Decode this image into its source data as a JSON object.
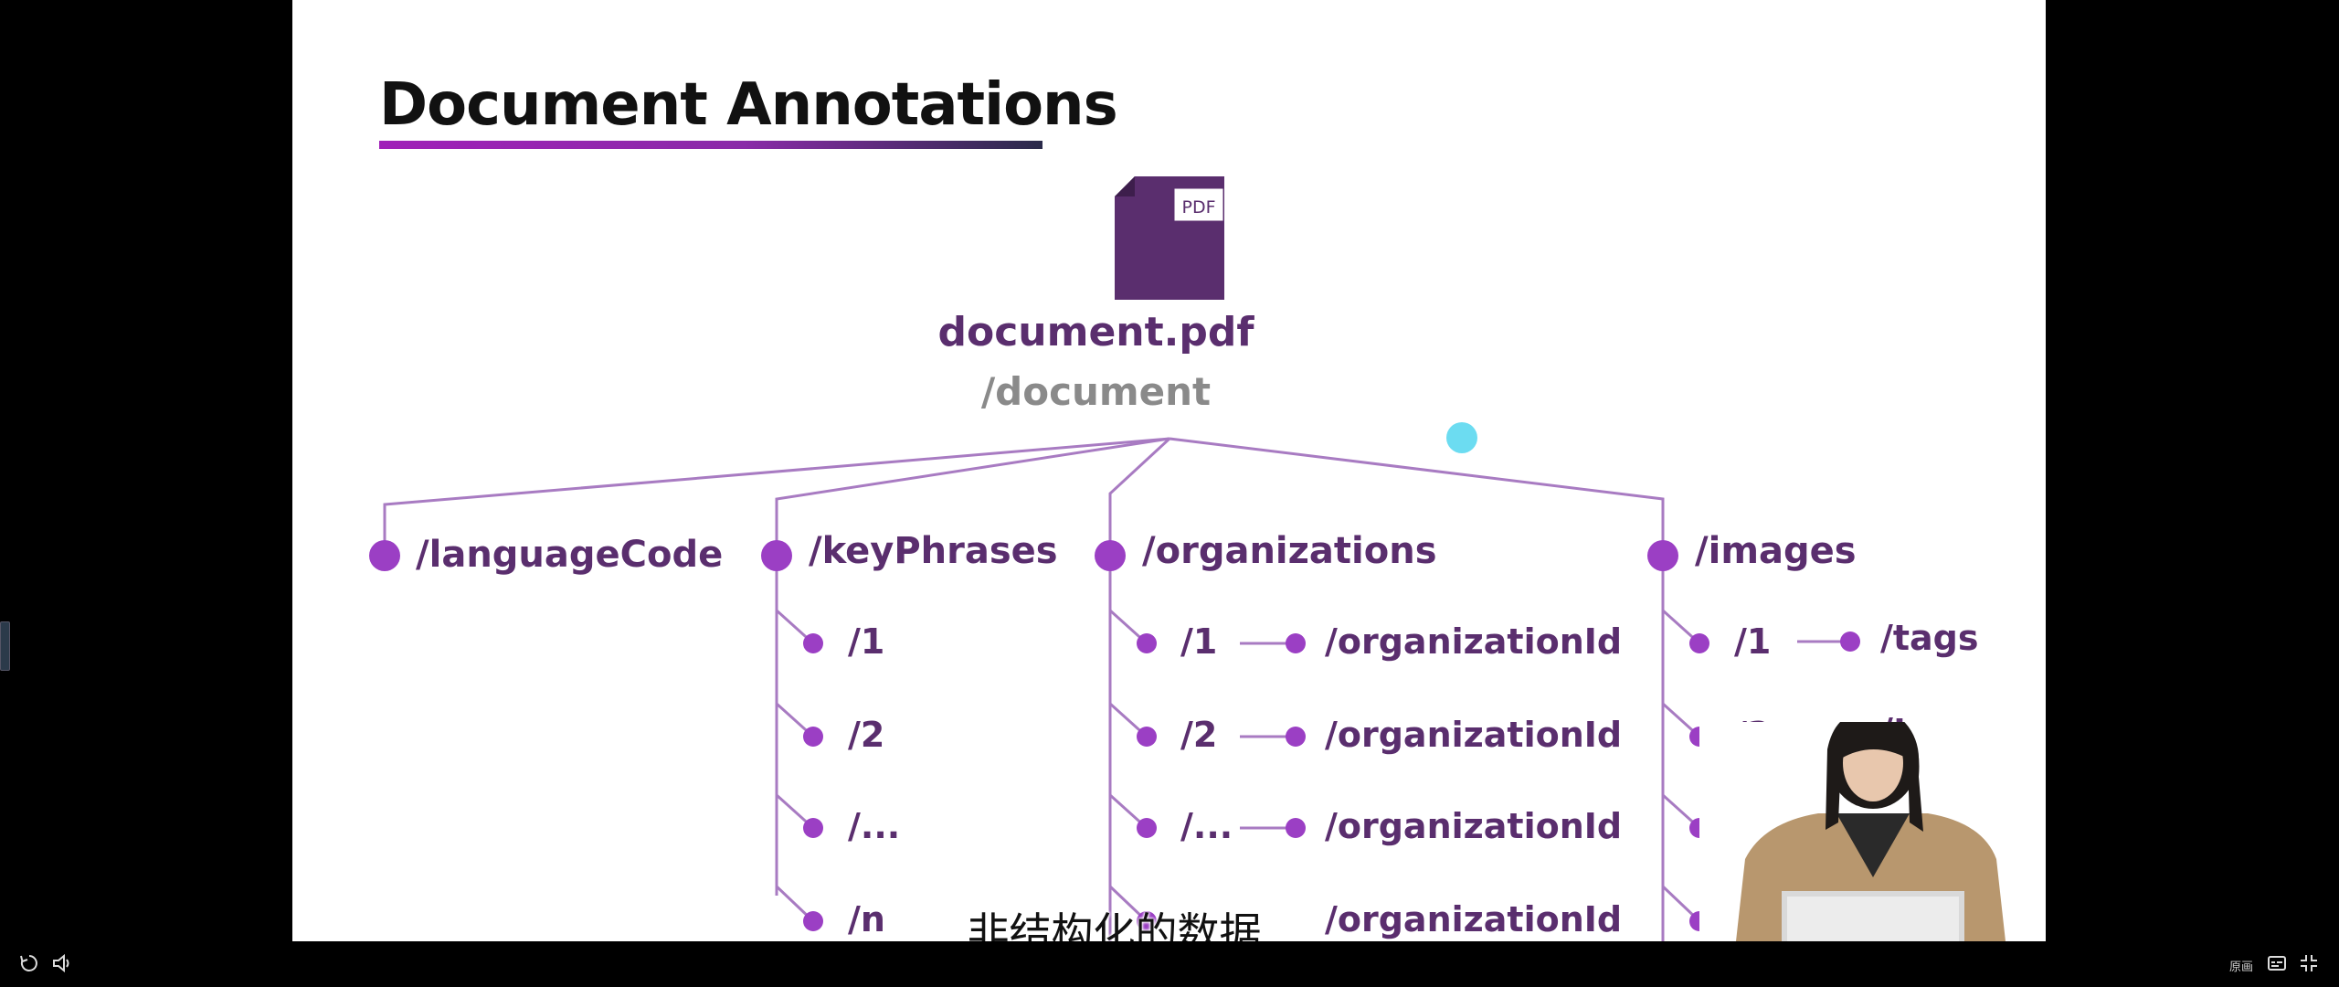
{
  "slide": {
    "title": "Document Annotations",
    "document_name": "document.pdf",
    "document_path": "/document",
    "pdf_badge": "PDF"
  },
  "tree": {
    "languageCode": "/languageCode",
    "keyPhrases": {
      "label": "/keyPhrases",
      "items": [
        "/1",
        "/2",
        "/...",
        "/n"
      ]
    },
    "organizations": {
      "label": "/organizations",
      "items": [
        "/1",
        "/2",
        "/...",
        ""
      ],
      "child": "/organizationId"
    },
    "images": {
      "label": "/images",
      "items": [
        "/1",
        "/2",
        "/...",
        ""
      ],
      "child": "/tags"
    }
  },
  "subtitle": "非结构化的数据",
  "player": {
    "quality_label": "原画"
  },
  "colors": {
    "accent": "#9b3fc4",
    "text_purple": "#5a2e6e",
    "line": "#a87bc2",
    "cursor": "#5cd8f0"
  }
}
